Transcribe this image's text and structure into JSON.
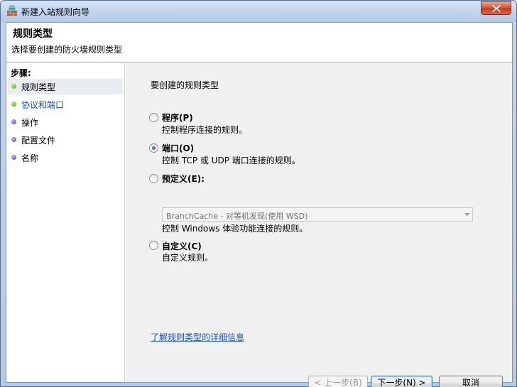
{
  "window": {
    "title": "新建入站规则向导",
    "icon": "firewall-icon",
    "close_icon": "close-icon"
  },
  "header": {
    "title": "规则类型",
    "subtitle": "选择要创建的防火墙规则类型"
  },
  "steps": {
    "title": "步骤:",
    "items": [
      {
        "label": "规则类型",
        "status": "green",
        "active": true
      },
      {
        "label": "协议和端口",
        "status": "green",
        "active": false
      },
      {
        "label": "操作",
        "status": "blue",
        "active": false
      },
      {
        "label": "配置文件",
        "status": "blue",
        "active": false
      },
      {
        "label": "名称",
        "status": "blue",
        "active": false
      }
    ]
  },
  "main": {
    "prompt": "要创建的规则类型",
    "options": [
      {
        "label": "程序(P)",
        "description": "控制程序连接的规则。",
        "checked": false
      },
      {
        "label": "端口(O)",
        "description": "控制 TCP 或 UDP 端口连接的规则。",
        "checked": true
      },
      {
        "label": "预定义(E):",
        "description": "控制 Windows 体验功能连接的规则。",
        "checked": false
      },
      {
        "label": "自定义(C)",
        "description": "自定义规则。",
        "checked": false
      }
    ],
    "predefined_select": "BranchCache - 对等机发现(使用 WSD)",
    "learn_more": "了解规则类型的详细信息"
  },
  "buttons": {
    "back": "< 上一步(B)",
    "next": "下一步(N) >",
    "cancel": "取消"
  },
  "colors": {
    "link": "#1b53b4",
    "close_button": "#c13b22"
  }
}
